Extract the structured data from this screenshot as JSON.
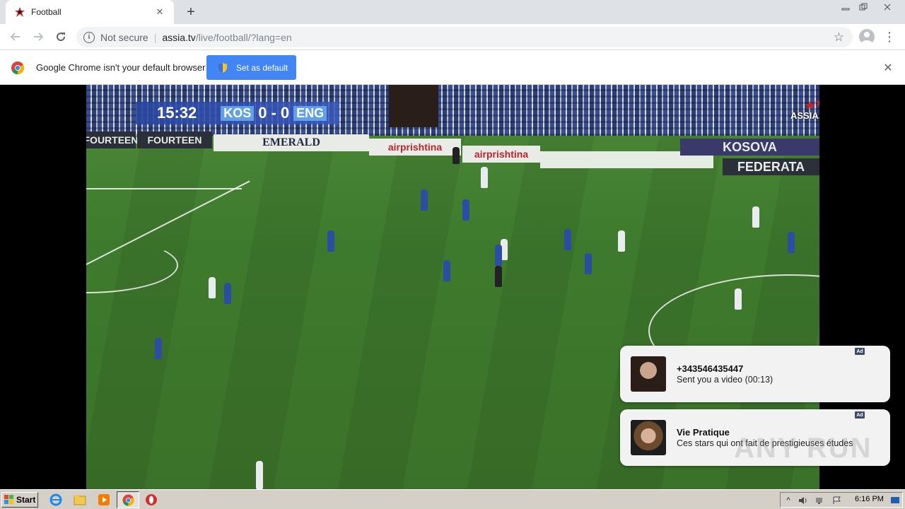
{
  "browser": {
    "tab": {
      "title": "Football"
    },
    "new_tab_symbol": "+",
    "address": {
      "security_label": "Not secure",
      "host": "assia.tv",
      "path": "/live/football/?lang=en"
    },
    "infobar": {
      "message": "Google Chrome isn't your default browser",
      "button_label": "Set as default"
    }
  },
  "video": {
    "scoreboard": {
      "time": "15:32",
      "home_team": "KOS",
      "home_score": "0",
      "separator": "-",
      "away_score": "0",
      "away_team": "ENG"
    },
    "channel_logo_text": "ASSIA.TV",
    "ad_boards": [
      "FOURTEEN",
      "FOURTEEN",
      "EMERALD",
      "airprishtina",
      "airprishtina",
      "KOSOVA",
      "FEDERATA"
    ]
  },
  "notifications": [
    {
      "tag": "Ad",
      "title": "+343546435447",
      "body": "Sent you a video (00:13)"
    },
    {
      "tag": "Ad",
      "title": "Vie Pratique",
      "body": "Ces stars qui ont fait de prestigieuses études"
    }
  ],
  "watermark": "ANY RUN",
  "taskbar": {
    "start_label": "Start",
    "clock": "6:16 PM"
  },
  "colors": {
    "infobar_button": "#4285f4",
    "pitch": "#3e7a2d",
    "taskbar": "#d4d0c8"
  }
}
